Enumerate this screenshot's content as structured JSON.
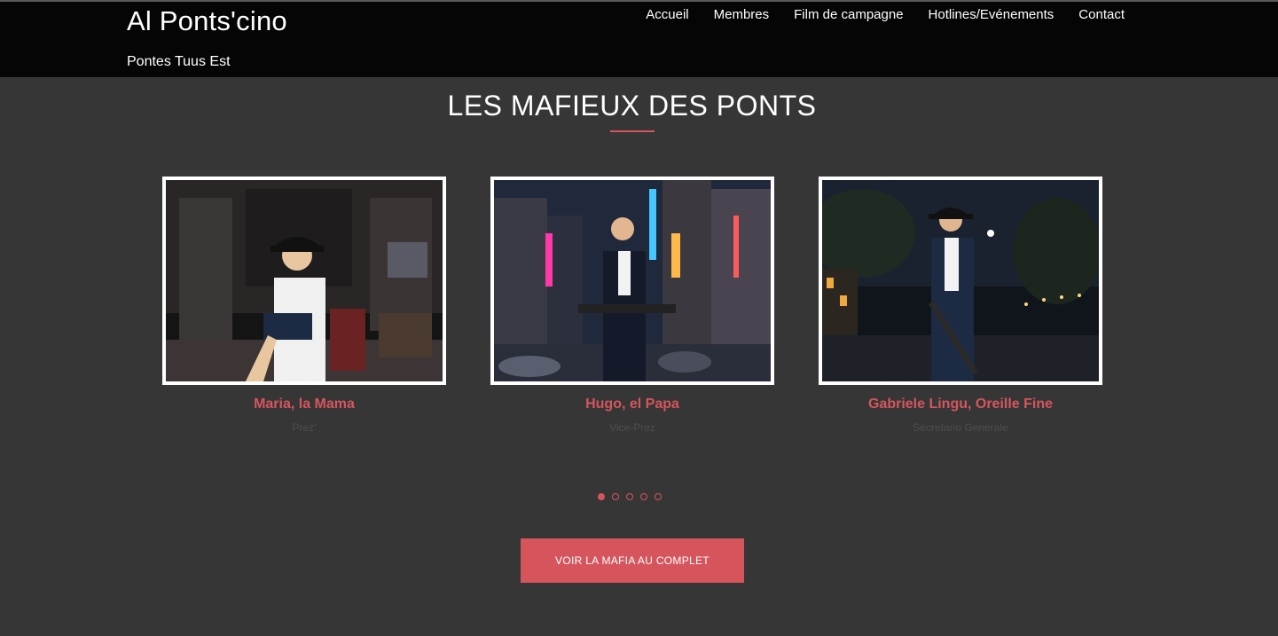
{
  "site": {
    "title": "Al Ponts'cino",
    "tagline": "Pontes Tuus Est"
  },
  "nav": {
    "items": [
      {
        "label": "Accueil"
      },
      {
        "label": "Membres"
      },
      {
        "label": "Film de campagne"
      },
      {
        "label": "Hotlines/Evénements"
      },
      {
        "label": "Contact"
      }
    ]
  },
  "section": {
    "title": "LES MAFIEUX DES PONTS"
  },
  "members": [
    {
      "name": "Maria, la Mama",
      "role": "Prez'",
      "photo": "office-scene-photo"
    },
    {
      "name": "Hugo, el Papa",
      "role": "Vice-Prez",
      "photo": "city-night-scene-photo"
    },
    {
      "name": "Gabriele Lingu, Oreille Fine",
      "role": "Secretario Generale",
      "photo": "night-street-scene-photo"
    }
  ],
  "carousel": {
    "total": 5,
    "active": 1
  },
  "cta": {
    "label": "VOIR LA MAFIA AU COMPLET"
  },
  "colors": {
    "accent": "#d6555d",
    "background": "#363636",
    "header": "#050505"
  }
}
